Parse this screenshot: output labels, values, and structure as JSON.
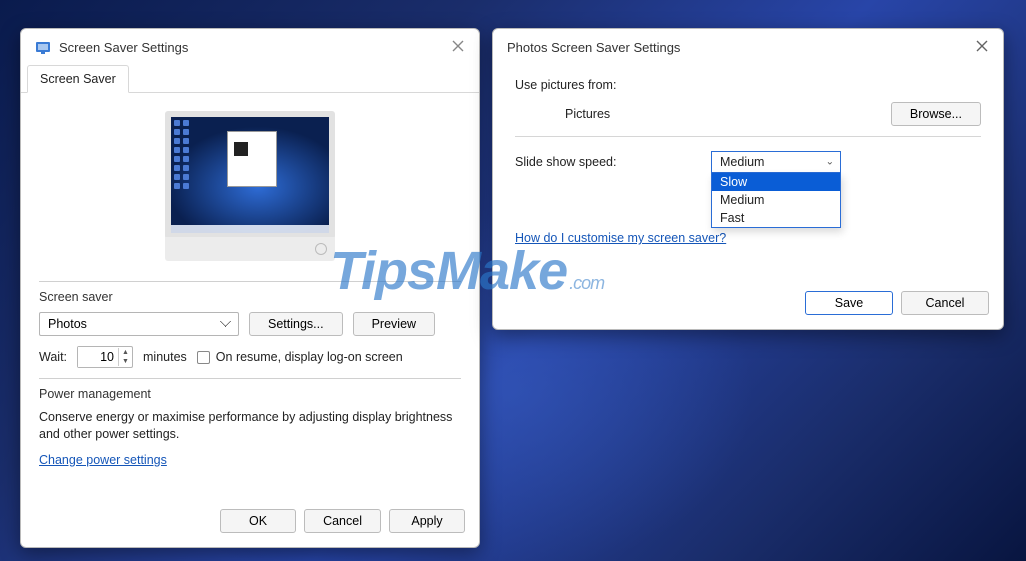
{
  "left": {
    "title": "Screen Saver Settings",
    "tab": "Screen Saver",
    "group_saver_title": "Screen saver",
    "saver_selected": "Photos",
    "settings_btn": "Settings...",
    "preview_btn": "Preview",
    "wait_label": "Wait:",
    "wait_value": "10",
    "wait_unit": "minutes",
    "resume_label": "On resume, display log-on screen",
    "group_power_title": "Power management",
    "power_desc": "Conserve energy or maximise performance by adjusting display brightness and other power settings.",
    "power_link": "Change power settings",
    "ok": "OK",
    "cancel": "Cancel",
    "apply": "Apply"
  },
  "right": {
    "title": "Photos Screen Saver Settings",
    "use_label": "Use pictures from:",
    "folder": "Pictures",
    "browse": "Browse...",
    "speed_label": "Slide show speed:",
    "speed_selected": "Medium",
    "speed_options": {
      "0": "Slow",
      "1": "Medium",
      "2": "Fast"
    },
    "help_link": "How do I customise my screen saver?",
    "save": "Save",
    "cancel": "Cancel"
  },
  "watermark": {
    "t": "T",
    "rest": "ipsMake",
    "com": ".com"
  }
}
